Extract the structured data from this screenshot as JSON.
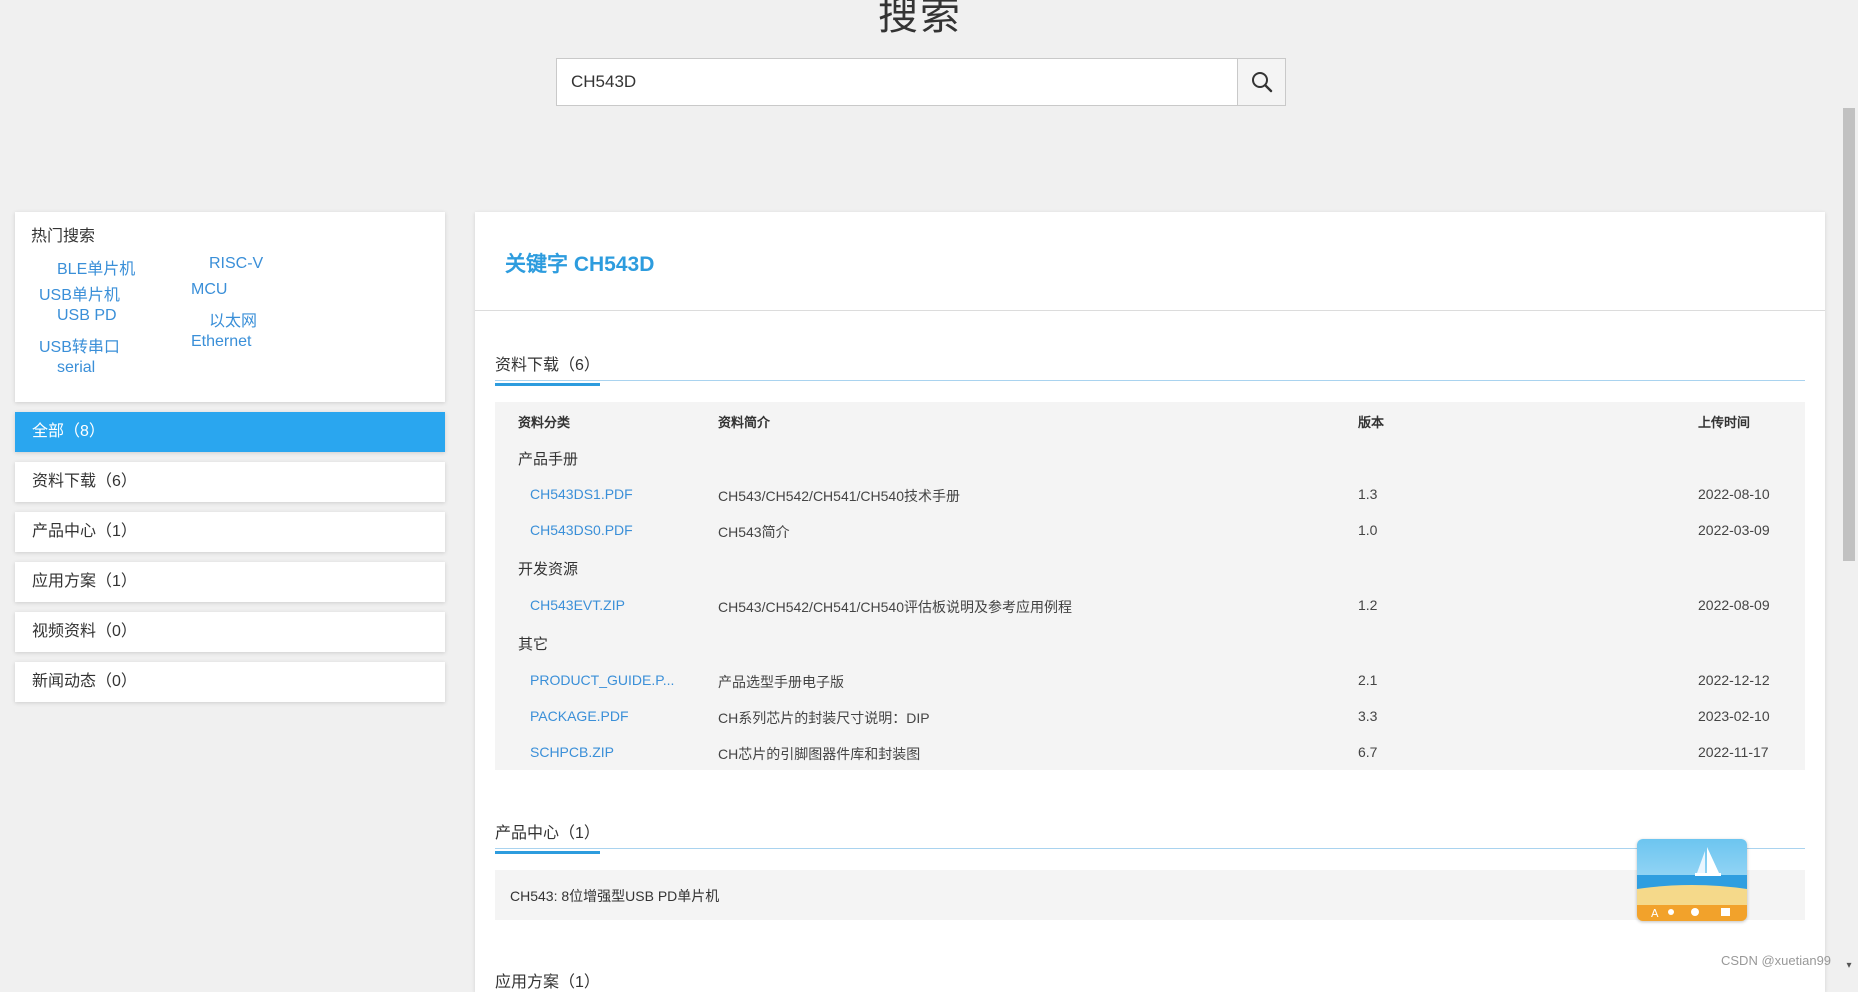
{
  "header": {
    "title": "搜索",
    "search_value": "CH543D"
  },
  "hot_search": {
    "title": "热门搜索",
    "links": [
      "BLE单片机",
      "RISC-V",
      "USB单片机",
      "MCU",
      "USB PD",
      "以太网",
      "USB转串口",
      "Ethernet",
      "serial"
    ]
  },
  "categories": [
    {
      "label": "全部（8）",
      "active": true
    },
    {
      "label": "资料下载（6）",
      "active": false
    },
    {
      "label": "产品中心（1）",
      "active": false
    },
    {
      "label": "应用方案（1）",
      "active": false
    },
    {
      "label": "视频资料（0）",
      "active": false
    },
    {
      "label": "新闻动态（0）",
      "active": false
    }
  ],
  "main": {
    "keyword_title": "关键字 CH543D",
    "downloads_tab": "资料下载（6）",
    "table": {
      "headers": [
        "资料分类",
        "资料简介",
        "版本",
        "上传时间"
      ],
      "groups": [
        {
          "name": "产品手册",
          "rows": [
            {
              "file": "CH543DS1.PDF",
              "desc": "CH543/CH542/CH541/CH540技术手册",
              "version": "1.3",
              "date": "2022-08-10"
            },
            {
              "file": "CH543DS0.PDF",
              "desc": "CH543简介",
              "version": "1.0",
              "date": "2022-03-09"
            }
          ]
        },
        {
          "name": "开发资源",
          "rows": [
            {
              "file": "CH543EVT.ZIP",
              "desc": "CH543/CH542/CH541/CH540评估板说明及参考应用例程",
              "version": "1.2",
              "date": "2022-08-09"
            }
          ]
        },
        {
          "name": "其它",
          "rows": [
            {
              "file": "PRODUCT_GUIDE.P...",
              "desc": "产品选型手册电子版",
              "version": "2.1",
              "date": "2022-12-12"
            },
            {
              "file": "PACKAGE.PDF",
              "desc": "CH系列芯片的封装尺寸说明：DIP",
              "version": "3.3",
              "date": "2023-02-10"
            },
            {
              "file": "SCHPCB.ZIP",
              "desc": "CH芯片的引脚图器件库和封装图",
              "version": "6.7",
              "date": "2022-11-17"
            }
          ]
        }
      ]
    },
    "products_tab": "产品中心（1）",
    "product_item": "CH543: 8位增强型USB PD单片机",
    "solutions_tab": "应用方案（1）"
  },
  "watermark": "CSDN @xuetian99",
  "colors": {
    "accent": "#2aa6ef",
    "link": "#3a8fd8",
    "title": "#2d9cde"
  }
}
